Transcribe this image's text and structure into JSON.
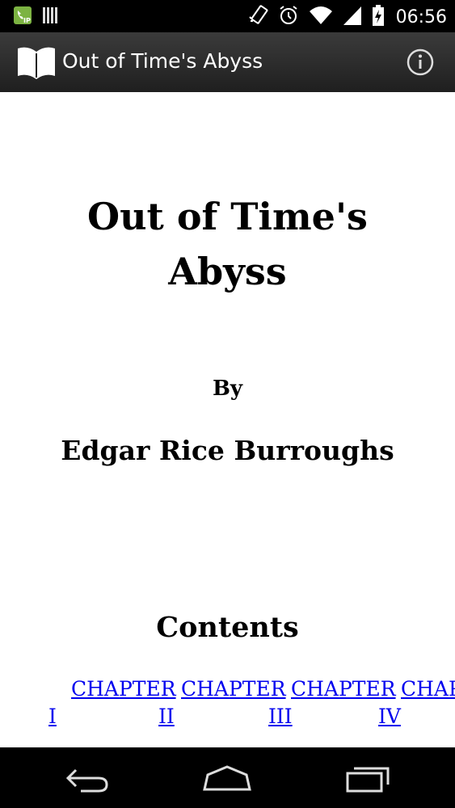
{
  "status_bar": {
    "time": "06:56",
    "icons": [
      "sip-call-icon",
      "barcode-icon",
      "vibrate-icon",
      "alarm-icon",
      "wifi-icon",
      "signal-icon",
      "battery-charging-icon"
    ],
    "colors": {
      "background": "#000000",
      "sip_green": "#7cb342"
    }
  },
  "action_bar": {
    "title": "Out of Time's Abyss",
    "app_icon": "book-icon",
    "info_icon": "info-icon"
  },
  "content": {
    "book_title": "Out of Time's Abyss",
    "by_label": "By",
    "author": "Edgar Rice Burroughs",
    "contents_heading": "Contents",
    "chapters": [
      {
        "word": "CHAPTER",
        "num": "I"
      },
      {
        "word": "CHAPTER",
        "num": "II"
      },
      {
        "word": "CHAPTER",
        "num": "III"
      },
      {
        "word": "CHAPTER",
        "num": "IV"
      }
    ],
    "link_color": "#0000ee"
  },
  "nav_bar": {
    "buttons": [
      "back-icon",
      "home-icon",
      "recent-apps-icon"
    ]
  }
}
